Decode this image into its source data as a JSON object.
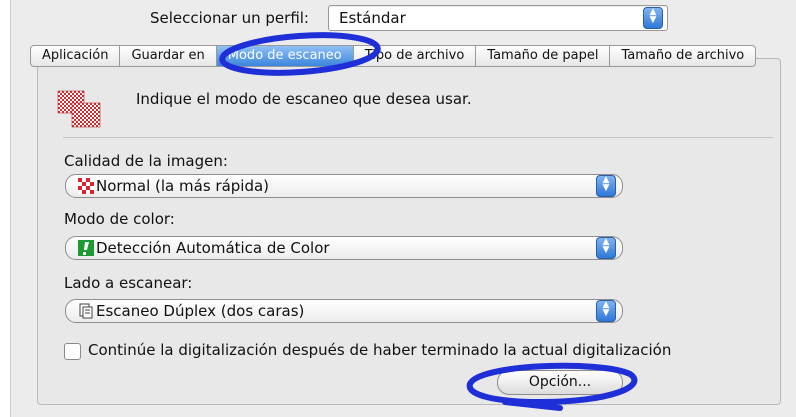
{
  "profile": {
    "label": "Seleccionar un perfil:",
    "value": "Estándar"
  },
  "tabs": [
    {
      "label": "Aplicación",
      "active": false
    },
    {
      "label": "Guardar en",
      "active": false
    },
    {
      "label": "Modo de escaneo",
      "active": true
    },
    {
      "label": "Tipo de archivo",
      "active": false
    },
    {
      "label": "Tamaño de papel",
      "active": false
    },
    {
      "label": "Tamaño de archivo",
      "active": false
    }
  ],
  "intro_text": "Indique el modo de escaneo que desea usar.",
  "image_quality": {
    "label": "Calidad de la imagen:",
    "value": "Normal (la más rápida)"
  },
  "color_mode": {
    "label": "Modo de color:",
    "value": "Detección Automática de Color"
  },
  "scan_side": {
    "label": "Lado a escanear:",
    "value": "Escaneo Dúplex (dos caras)"
  },
  "continue_checkbox": {
    "label": "Continúe la digitalización después  de haber terminado la actual digitalización",
    "checked": false
  },
  "option_button": "Opción...",
  "colors": {
    "accent": "#3b86dd",
    "annotation": "#1f2fd8"
  }
}
